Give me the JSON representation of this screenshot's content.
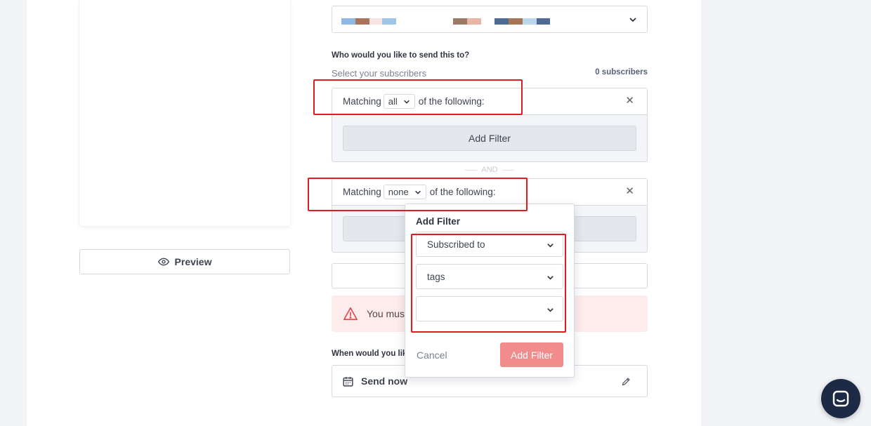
{
  "preview": {
    "label": "Preview"
  },
  "sender": {
    "swatches": [
      {
        "color": "#8fb8e0"
      },
      {
        "color": "#a9745b"
      },
      {
        "color": "#f7e4e4"
      },
      {
        "color": "#9ec4e6"
      },
      {
        "color": "#9b7a66"
      },
      {
        "color": "#e6b6a6"
      },
      {
        "color": "#4f6b93"
      },
      {
        "color": "#a57655"
      },
      {
        "color": "#bcd6ea"
      },
      {
        "color": "#4f6b93"
      }
    ]
  },
  "recipients": {
    "question": "Who would you like to send this to?",
    "select_label": "Select your subscribers",
    "count": "0 subscribers"
  },
  "groups": [
    {
      "prefix": "Matching",
      "mode": "all",
      "suffix": "of the following:",
      "add_filter": "Add Filter"
    },
    {
      "prefix": "Matching",
      "mode": "none",
      "suffix": "of the following:"
    }
  ],
  "separator": "AND",
  "alert": {
    "text": "You mus"
  },
  "schedule": {
    "question": "When would you lik",
    "value": "Send now"
  },
  "popover": {
    "title": "Add Filter",
    "field1": "Subscribed to",
    "field2": "tags",
    "field3": "",
    "cancel": "Cancel",
    "submit": "Add Filter"
  },
  "colors": {
    "highlight": "#e11b22",
    "primary_disabled": "#f28b8b",
    "chat": "#1d2a45"
  }
}
